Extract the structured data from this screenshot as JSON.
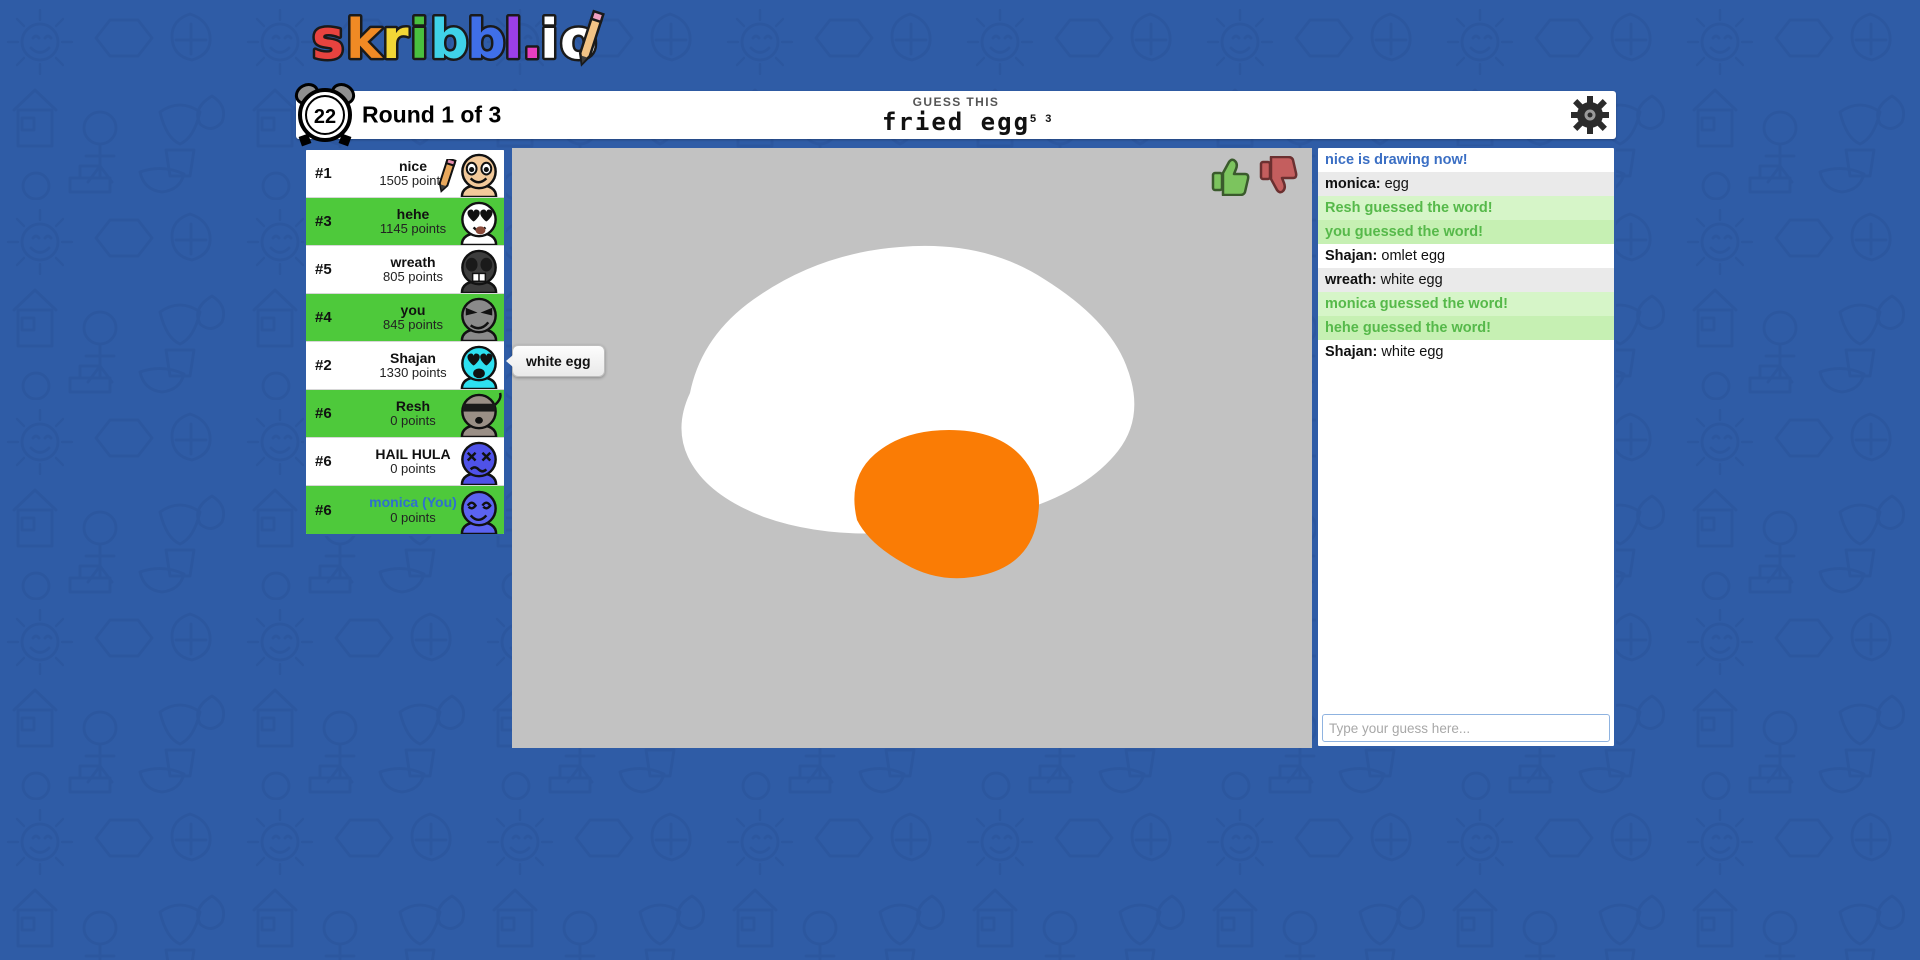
{
  "brand": {
    "name": "skribbl.io",
    "letters": [
      {
        "ch": "s",
        "color": "#e8433f"
      },
      {
        "ch": "k",
        "color": "#f08a24"
      },
      {
        "ch": "r",
        "color": "#f2d636"
      },
      {
        "ch": "i",
        "color": "#49c03f"
      },
      {
        "ch": "b",
        "color": "#3fd2e8"
      },
      {
        "ch": "b",
        "color": "#3f6fe8"
      },
      {
        "ch": "l",
        "color": "#9b3fe8"
      },
      {
        "ch": ".",
        "color": "#e83fc0"
      },
      {
        "ch": "i",
        "color": "#ffffff"
      },
      {
        "ch": "o",
        "color": "#ffffff"
      }
    ],
    "pencil_icon": "pencil-icon"
  },
  "topbar": {
    "timer": "22",
    "timer_icon": "alarm-clock-icon",
    "round": "Round 1 of 3",
    "guess_this_label": "GUESS THIS",
    "word": "fried egg",
    "word_hints": "5 3",
    "settings_icon": "gear-icon"
  },
  "players": [
    {
      "rank": "#1",
      "name": "nice",
      "points": "1505 points",
      "guessed": false,
      "self": false,
      "drawing": true,
      "avatar_color": "#f2c99a",
      "eyes": "normal",
      "mouth": "smile"
    },
    {
      "rank": "#3",
      "name": "hehe",
      "points": "1145 points",
      "guessed": true,
      "self": false,
      "drawing": false,
      "avatar_color": "#ffffff",
      "eyes": "heart",
      "mouth": "tongue"
    },
    {
      "rank": "#5",
      "name": "wreath",
      "points": "805 points",
      "guessed": false,
      "self": false,
      "drawing": false,
      "avatar_color": "#3d3d3d",
      "eyes": "mask",
      "mouth": "teeth"
    },
    {
      "rank": "#4",
      "name": "you",
      "points": "845 points",
      "guessed": true,
      "self": false,
      "drawing": false,
      "avatar_color": "#8a8a8a",
      "eyes": "angry",
      "mouth": "smirk"
    },
    {
      "rank": "#2",
      "name": "Shajan",
      "points": "1330 points",
      "guessed": false,
      "self": false,
      "drawing": false,
      "avatar_color": "#2de0f0",
      "eyes": "heart",
      "mouth": "open"
    },
    {
      "rank": "#6",
      "name": "Resh",
      "points": "0 points",
      "guessed": true,
      "self": false,
      "drawing": false,
      "avatar_color": "#9a8f86",
      "eyes": "band",
      "mouth": "dot"
    },
    {
      "rank": "#6",
      "name": "HAIL HULA",
      "points": "0 points",
      "guessed": false,
      "self": false,
      "drawing": false,
      "avatar_color": "#4f52e8",
      "eyes": "cross",
      "mouth": "wavy"
    },
    {
      "rank": "#6",
      "name": "monica (You)",
      "points": "0 points",
      "guessed": true,
      "self": true,
      "drawing": false,
      "avatar_color": "#5b63f0",
      "eyes": "swirl",
      "mouth": "grin"
    }
  ],
  "canvas": {
    "background_color": "#c2c2c2",
    "egg_white_color": "#ffffff",
    "yolk_color": "#fa7c05",
    "like_icon": "thumbs-up-icon",
    "dislike_icon": "thumbs-down-icon",
    "like_color": "#7cc45e",
    "dislike_color": "#c45e5e"
  },
  "tooltip": {
    "text": "white egg"
  },
  "chat": {
    "messages": [
      {
        "type": "system",
        "text": "nice is drawing now!",
        "alt": false
      },
      {
        "type": "guess",
        "who": "monica:",
        "text": "egg",
        "alt": true
      },
      {
        "type": "success",
        "text": "Resh guessed the word!",
        "alt": false
      },
      {
        "type": "success",
        "text": "you guessed the word!",
        "alt": true
      },
      {
        "type": "guess",
        "who": "Shajan:",
        "text": "omlet egg",
        "alt": false
      },
      {
        "type": "guess",
        "who": "wreath:",
        "text": "white egg",
        "alt": true
      },
      {
        "type": "success",
        "text": "monica guessed the word!",
        "alt": false
      },
      {
        "type": "success",
        "text": "hehe guessed the word!",
        "alt": true
      },
      {
        "type": "guess",
        "who": "Shajan:",
        "text": "white egg",
        "alt": false
      }
    ],
    "input_placeholder": "Type your guess here...",
    "input_value": ""
  },
  "colors": {
    "page_background": "#2f5ca6",
    "doodle_stroke": "#2a539a",
    "panel_border": "#2f5ca6",
    "guessed_row": "#4ec93b",
    "self_name": "#2f6fd0",
    "system_text": "#3b6fc4",
    "success_text": "#56b94a"
  }
}
